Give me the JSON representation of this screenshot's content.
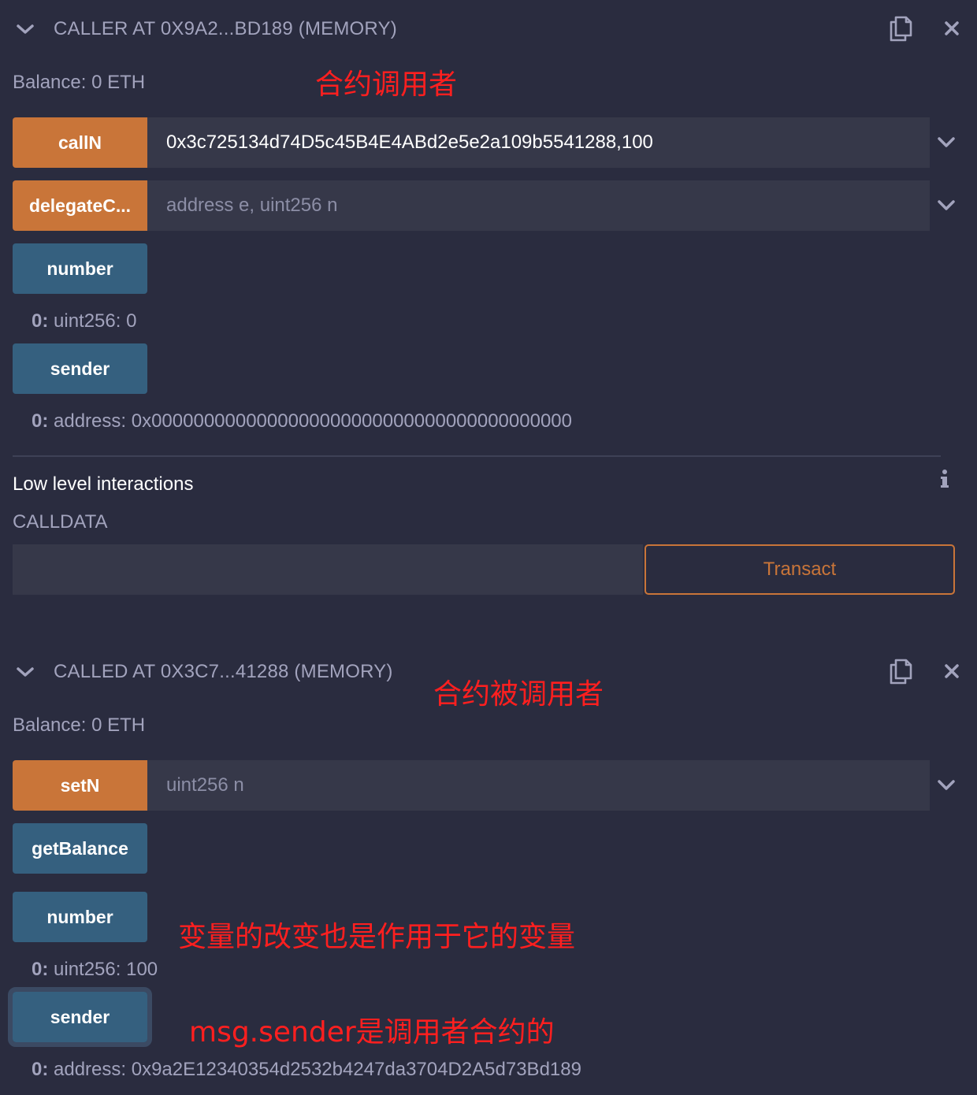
{
  "caller": {
    "title": "CALLER AT 0X9A2...BD189 (MEMORY)",
    "balance": "Balance: 0 ETH",
    "annotation": "合约调用者",
    "functions": {
      "callN": {
        "label": "callN",
        "value": "0x3c725134d74D5c45B4E4ABd2e5e2a109b5541288,100"
      },
      "delegateCall": {
        "label": "delegateC...",
        "placeholder": "address e, uint256 n"
      },
      "number": {
        "label": "number",
        "result_prefix": "0:",
        "result": "uint256: 0"
      },
      "sender": {
        "label": "sender",
        "result_prefix": "0:",
        "result": "address: 0x0000000000000000000000000000000000000000"
      }
    },
    "low_level": {
      "heading": "Low level interactions",
      "calldata_label": "CALLDATA",
      "transact_label": "Transact"
    }
  },
  "called": {
    "title": "CALLED AT 0X3C7...41288 (MEMORY)",
    "balance": "Balance: 0 ETH",
    "annotation": "合约被调用者",
    "functions": {
      "setN": {
        "label": "setN",
        "placeholder": "uint256 n"
      },
      "getBalance": {
        "label": "getBalance"
      },
      "number": {
        "label": "number",
        "result_prefix": "0:",
        "result": "uint256: 100",
        "annotation": "变量的改变也是作用于它的变量"
      },
      "sender": {
        "label": "sender",
        "result_prefix": "0:",
        "result": "address: 0x9a2E12340354d2532b4247da3704D2A5d73Bd189",
        "annotation": "msg.sender是调用者合约的"
      }
    }
  },
  "colors": {
    "background": "#2a2c3f",
    "orange": "#c97539",
    "blue": "#35607f",
    "annotation": "#ff1f1f"
  },
  "icons": [
    "chevron-down-icon",
    "copy-icon",
    "close-icon",
    "info-icon"
  ]
}
